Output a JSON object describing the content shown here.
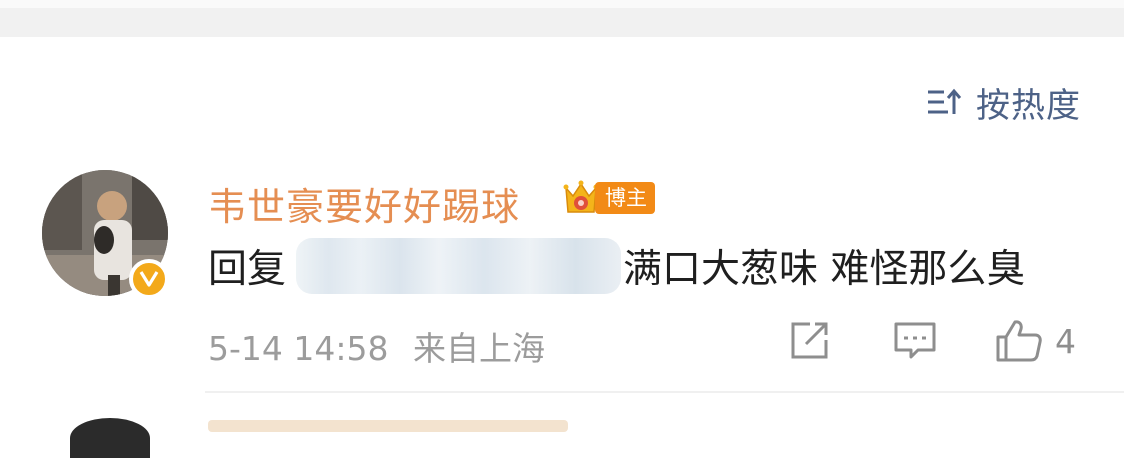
{
  "sort": {
    "label": "按热度",
    "icon": "sort-icon"
  },
  "comment": {
    "username": "韦世豪要好好踢球",
    "badge_label": "博主",
    "reply_prefix": "回复",
    "text": "满口大葱味 难怪那么臭",
    "date": "5-14 14:58",
    "source": "来自上海",
    "like_count": "4"
  },
  "colors": {
    "username": "#e58e52",
    "sort_text": "#4d6287",
    "badge": "#f28a16",
    "verified": "#f3a91a",
    "meta": "#9c9c9c"
  }
}
